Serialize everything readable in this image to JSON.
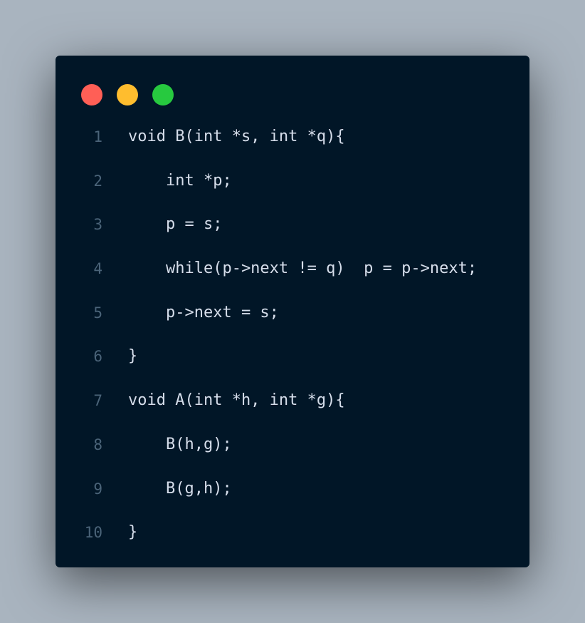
{
  "window": {
    "controls": [
      {
        "name": "close",
        "color": "#ff5f56"
      },
      {
        "name": "minimize",
        "color": "#ffbd2e"
      },
      {
        "name": "maximize",
        "color": "#27c93f"
      }
    ],
    "background_color": "#011627",
    "text_color": "#d6deeb",
    "line_number_color": "#4b6479"
  },
  "code": {
    "lines": [
      {
        "number": "1",
        "text": "void B(int *s, int *q){"
      },
      {
        "number": "2",
        "text": "    int *p;"
      },
      {
        "number": "3",
        "text": "    p = s;"
      },
      {
        "number": "4",
        "text": "    while(p->next != q)  p = p->next;"
      },
      {
        "number": "5",
        "text": "    p->next = s;"
      },
      {
        "number": "6",
        "text": "}"
      },
      {
        "number": "7",
        "text": "void A(int *h, int *g){"
      },
      {
        "number": "8",
        "text": "    B(h,g);"
      },
      {
        "number": "9",
        "text": "    B(g,h);"
      },
      {
        "number": "10",
        "text": "}"
      }
    ]
  }
}
